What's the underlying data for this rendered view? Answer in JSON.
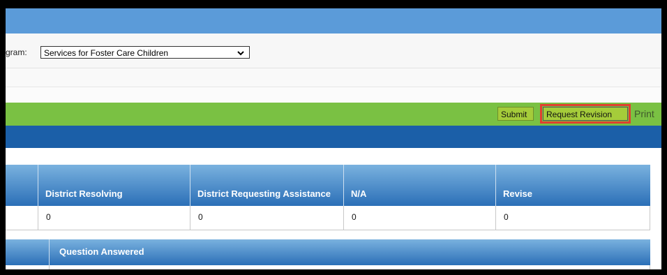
{
  "program": {
    "label": "gram:",
    "selected": "Services for Foster Care Children"
  },
  "toolbar": {
    "submit_label": "Submit",
    "request_revision_label": "Request Revision",
    "print_label": "Print"
  },
  "summary_table": {
    "headers": [
      "",
      "District Resolving",
      "District Requesting Assistance",
      "N/A",
      "Revise"
    ],
    "values": [
      "",
      "0",
      "0",
      "0",
      "0"
    ]
  },
  "question_table": {
    "headers": [
      "",
      "Question Answered"
    ]
  },
  "colors": {
    "top_bar": "#5b9bd9",
    "green_bar": "#7ac143",
    "blue_bar": "#1b5fa8",
    "highlight": "#e04030"
  },
  "icons": {
    "select_arrow": "chevron-down-icon"
  }
}
